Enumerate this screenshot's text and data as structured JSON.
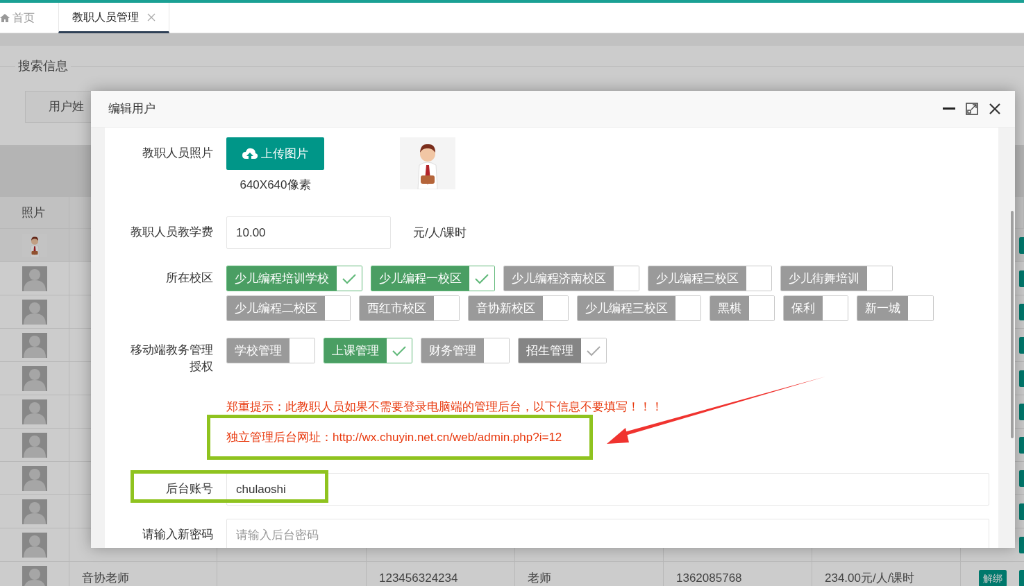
{
  "tabs": [
    {
      "label": "首页",
      "selected": false,
      "kind": "home"
    },
    {
      "label": "教职人员管理",
      "selected": true,
      "kind": "closable"
    }
  ],
  "search": {
    "legend": "搜索信息",
    "field_label": "用户姓"
  },
  "table": {
    "columns": [
      "照片"
    ],
    "rows": [
      {
        "photo": {
          "kind": "picture"
        }
      },
      {
        "photo": {
          "kind": "placeholder"
        }
      },
      {
        "photo": {
          "kind": "placeholder"
        }
      },
      {
        "photo": {
          "kind": "placeholder"
        }
      },
      {
        "photo": {
          "kind": "placeholder"
        }
      },
      {
        "photo": {
          "kind": "placeholder"
        }
      },
      {
        "photo": {
          "kind": "placeholder"
        }
      },
      {
        "photo": {
          "kind": "placeholder"
        }
      },
      {
        "photo": {
          "kind": "placeholder"
        }
      },
      {
        "photo": {
          "kind": "placeholder"
        }
      },
      {
        "photo": {
          "kind": "placeholder"
        },
        "cells": [
          "音协老师",
          "",
          "123456324234",
          "老师",
          "1362085768",
          "234.00元/人/课时"
        ],
        "action": "解绑"
      }
    ]
  },
  "dialog": {
    "title": "编辑用户",
    "photo": {
      "label": "教职人员照片",
      "button": "上传图片",
      "hint": "640X640像素",
      "preview": {
        "kind": "picture"
      }
    },
    "fee": {
      "label": "教职人员教学费",
      "value": "10.00",
      "unit": "元/人/课时"
    },
    "campus": {
      "label": "所在校区",
      "options": [
        {
          "label": "少儿编程培训学校",
          "checked": true,
          "disabled": false
        },
        {
          "label": "少儿编程一校区",
          "checked": true,
          "disabled": false
        },
        {
          "label": "少儿编程济南校区",
          "checked": false,
          "disabled": false
        },
        {
          "label": "少儿编程三校区",
          "checked": false,
          "disabled": false
        },
        {
          "label": "少儿街舞培训",
          "checked": false,
          "disabled": false
        },
        {
          "label": "少儿编程二校区",
          "checked": false,
          "disabled": false
        },
        {
          "label": "西红市校区",
          "checked": false,
          "disabled": false
        },
        {
          "label": "音协新校区",
          "checked": false,
          "disabled": false
        },
        {
          "label": "少儿编程三校区",
          "checked": false,
          "disabled": false
        },
        {
          "label": "黑棋",
          "checked": false,
          "disabled": false
        },
        {
          "label": "保利",
          "checked": false,
          "disabled": false
        },
        {
          "label": "新一城",
          "checked": false,
          "disabled": false
        }
      ]
    },
    "auth": {
      "label": "移动端教务管理授权",
      "options": [
        {
          "label": "学校管理",
          "checked": false,
          "disabled": false
        },
        {
          "label": "上课管理",
          "checked": true,
          "disabled": false
        },
        {
          "label": "财务管理",
          "checked": false,
          "disabled": false
        },
        {
          "label": "招生管理",
          "checked": true,
          "disabled": true
        }
      ]
    },
    "warning": "郑重提示：此教职人员如果不需要登录电脑端的管理后台，以下信息不要填写！！！",
    "admin_url": "独立管理后台网址：http://wx.chuyin.net.cn/web/admin.php?i=12",
    "account": {
      "label": "后台账号",
      "value": "chulaoshi"
    },
    "password": {
      "label": "请输入新密码",
      "placeholder": "请输入后台密码"
    }
  }
}
